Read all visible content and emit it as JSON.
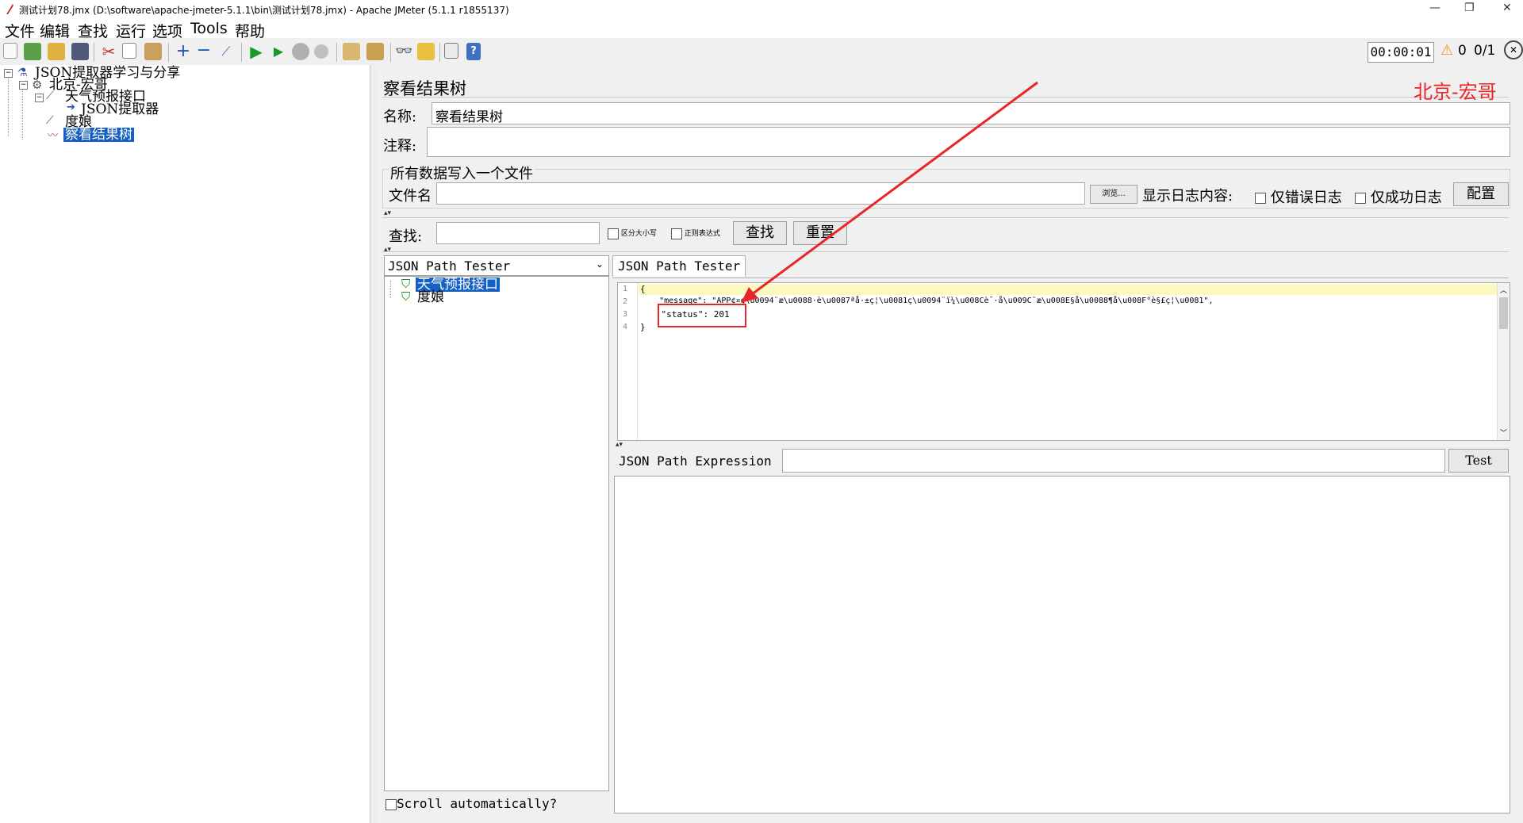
{
  "window": {
    "title": "测试计划78.jmx (D:\\software\\apache-jmeter-5.1.1\\bin\\测试计划78.jmx) - Apache JMeter (5.1.1 r1855137)",
    "minimize": "—",
    "restore": "❐",
    "close": "✕"
  },
  "menu": [
    "文件",
    "编辑",
    "查找",
    "运行",
    "选项",
    "Tools",
    "帮助"
  ],
  "status": {
    "timer": "00:00:01",
    "warnings": "0",
    "threads": "0/1"
  },
  "tree": {
    "nodes": [
      {
        "label": "JSON提取器学习与分享",
        "icon": "test-plan-icon"
      },
      {
        "label": "北京-宏哥",
        "icon": "thread-group-icon"
      },
      {
        "label": "天气预报接口",
        "icon": "http-sampler-icon"
      },
      {
        "label": "JSON提取器",
        "icon": "extractor-icon"
      },
      {
        "label": "度娘",
        "icon": "http-sampler-icon"
      },
      {
        "label": "察看结果树",
        "icon": "listener-icon"
      }
    ]
  },
  "panel": {
    "title": "察看结果树",
    "watermark": "北京-宏哥",
    "name_label": "名称:",
    "name_value": "察看结果树",
    "comment_label": "注释:",
    "comment_value": "",
    "file_group": "所有数据写入一个文件",
    "file_label": "文件名",
    "file_value": "",
    "browse_btn": "浏览...",
    "log_label": "显示日志内容:",
    "errors_only": "仅错误日志",
    "success_only": "仅成功日志",
    "configure_btn": "配置",
    "search_label": "查找:",
    "search_value": "",
    "case_sensitive": "区分大小写",
    "regex": "正则表达式",
    "find_btn": "查找",
    "reset_btn": "重置"
  },
  "results": {
    "renderer": "JSON Path Tester",
    "items": [
      "天气预报接口",
      "度娘"
    ],
    "scroll_auto": "Scroll automatically?",
    "tab": "JSON Path Tester",
    "code_lines": [
      {
        "n": "1",
        "text": "{"
      },
      {
        "n": "2",
        "text": "    \"message\": \"APP¢¤ç\\u0094¨æ\\u0088·è\\u0087ªå·±ç¦\\u0081ç\\u0094¨ï¼\\u008Cè¯·å\\u009C¨æ\\u008E§å\\u0088¶å\\u008F°è§£ç¦\\u0081\","
      },
      {
        "n": "3",
        "text": "    \"status\": 201"
      },
      {
        "n": "4",
        "text": "}"
      }
    ],
    "expr_label": "JSON Path Expression",
    "expr_value": "",
    "test_btn": "Test",
    "output": ""
  },
  "colors": {
    "selection": "#1560c4",
    "annotation": "#e8262a",
    "highlight_line": "#fbf9bf"
  }
}
